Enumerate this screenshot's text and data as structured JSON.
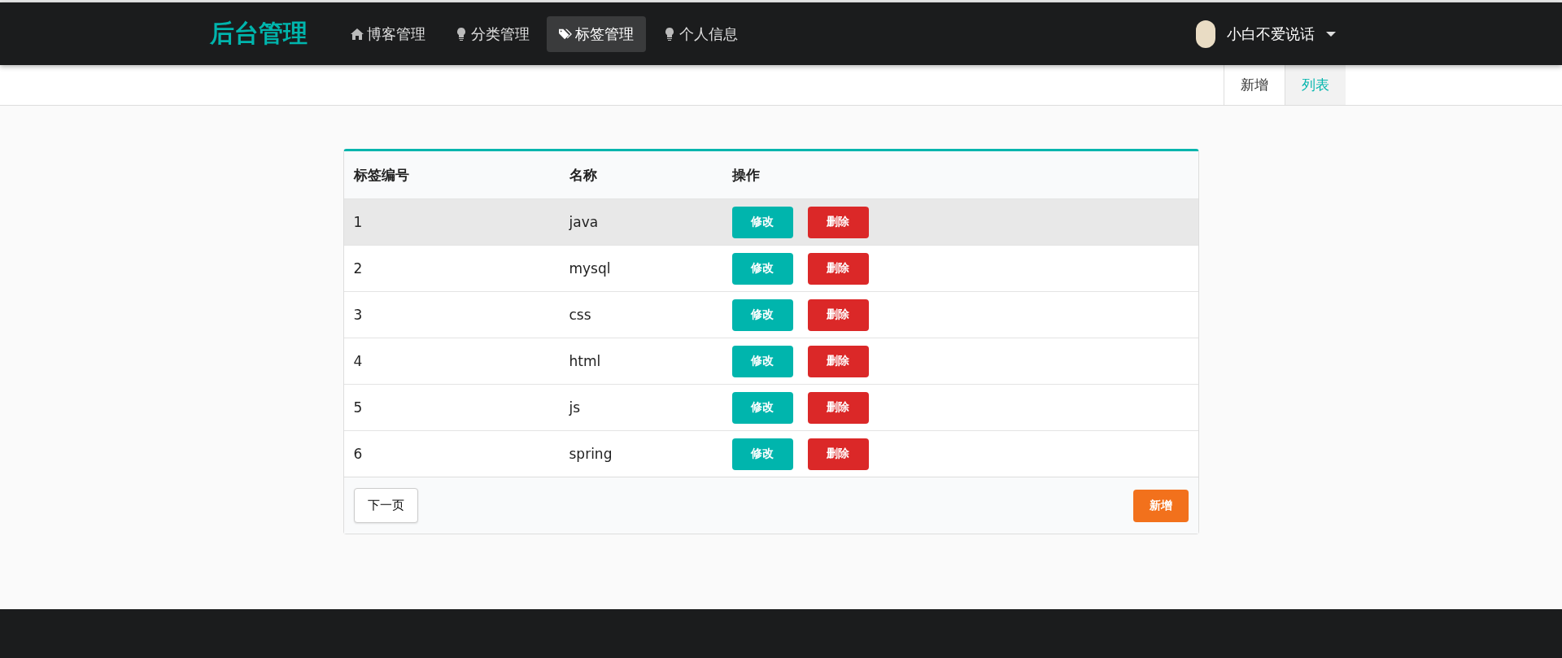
{
  "navbar": {
    "brand": "后台管理",
    "items": [
      {
        "label": "博客管理",
        "kind": "home",
        "selected": false
      },
      {
        "label": "分类管理",
        "kind": "bulb",
        "selected": false
      },
      {
        "label": "标签管理",
        "kind": "tags",
        "selected": true
      },
      {
        "label": "个人信息",
        "kind": "bulb",
        "selected": false
      }
    ],
    "user": {
      "name": "小白不爱说话"
    }
  },
  "subnav": {
    "tabs": [
      {
        "label": "新增",
        "selected": false
      },
      {
        "label": "列表",
        "selected": true
      }
    ]
  },
  "table": {
    "columns": [
      "标签编号",
      "名称",
      "操作"
    ],
    "rows": [
      {
        "id": "1",
        "name": "java",
        "selected": true,
        "actions": [
          "修改",
          "删除"
        ]
      },
      {
        "id": "2",
        "name": "mysql",
        "selected": false,
        "actions": [
          "修改",
          "删除"
        ]
      },
      {
        "id": "3",
        "name": "css",
        "selected": false,
        "actions": [
          "修改",
          "删除"
        ]
      },
      {
        "id": "4",
        "name": "html",
        "selected": false,
        "actions": [
          "修改",
          "删除"
        ]
      },
      {
        "id": "5",
        "name": "js",
        "selected": false,
        "actions": [
          "修改",
          "删除"
        ]
      },
      {
        "id": "6",
        "name": "spring",
        "selected": false,
        "actions": [
          "修改",
          "删除"
        ]
      }
    ],
    "next_button": "下一页",
    "add_button": "新增"
  }
}
